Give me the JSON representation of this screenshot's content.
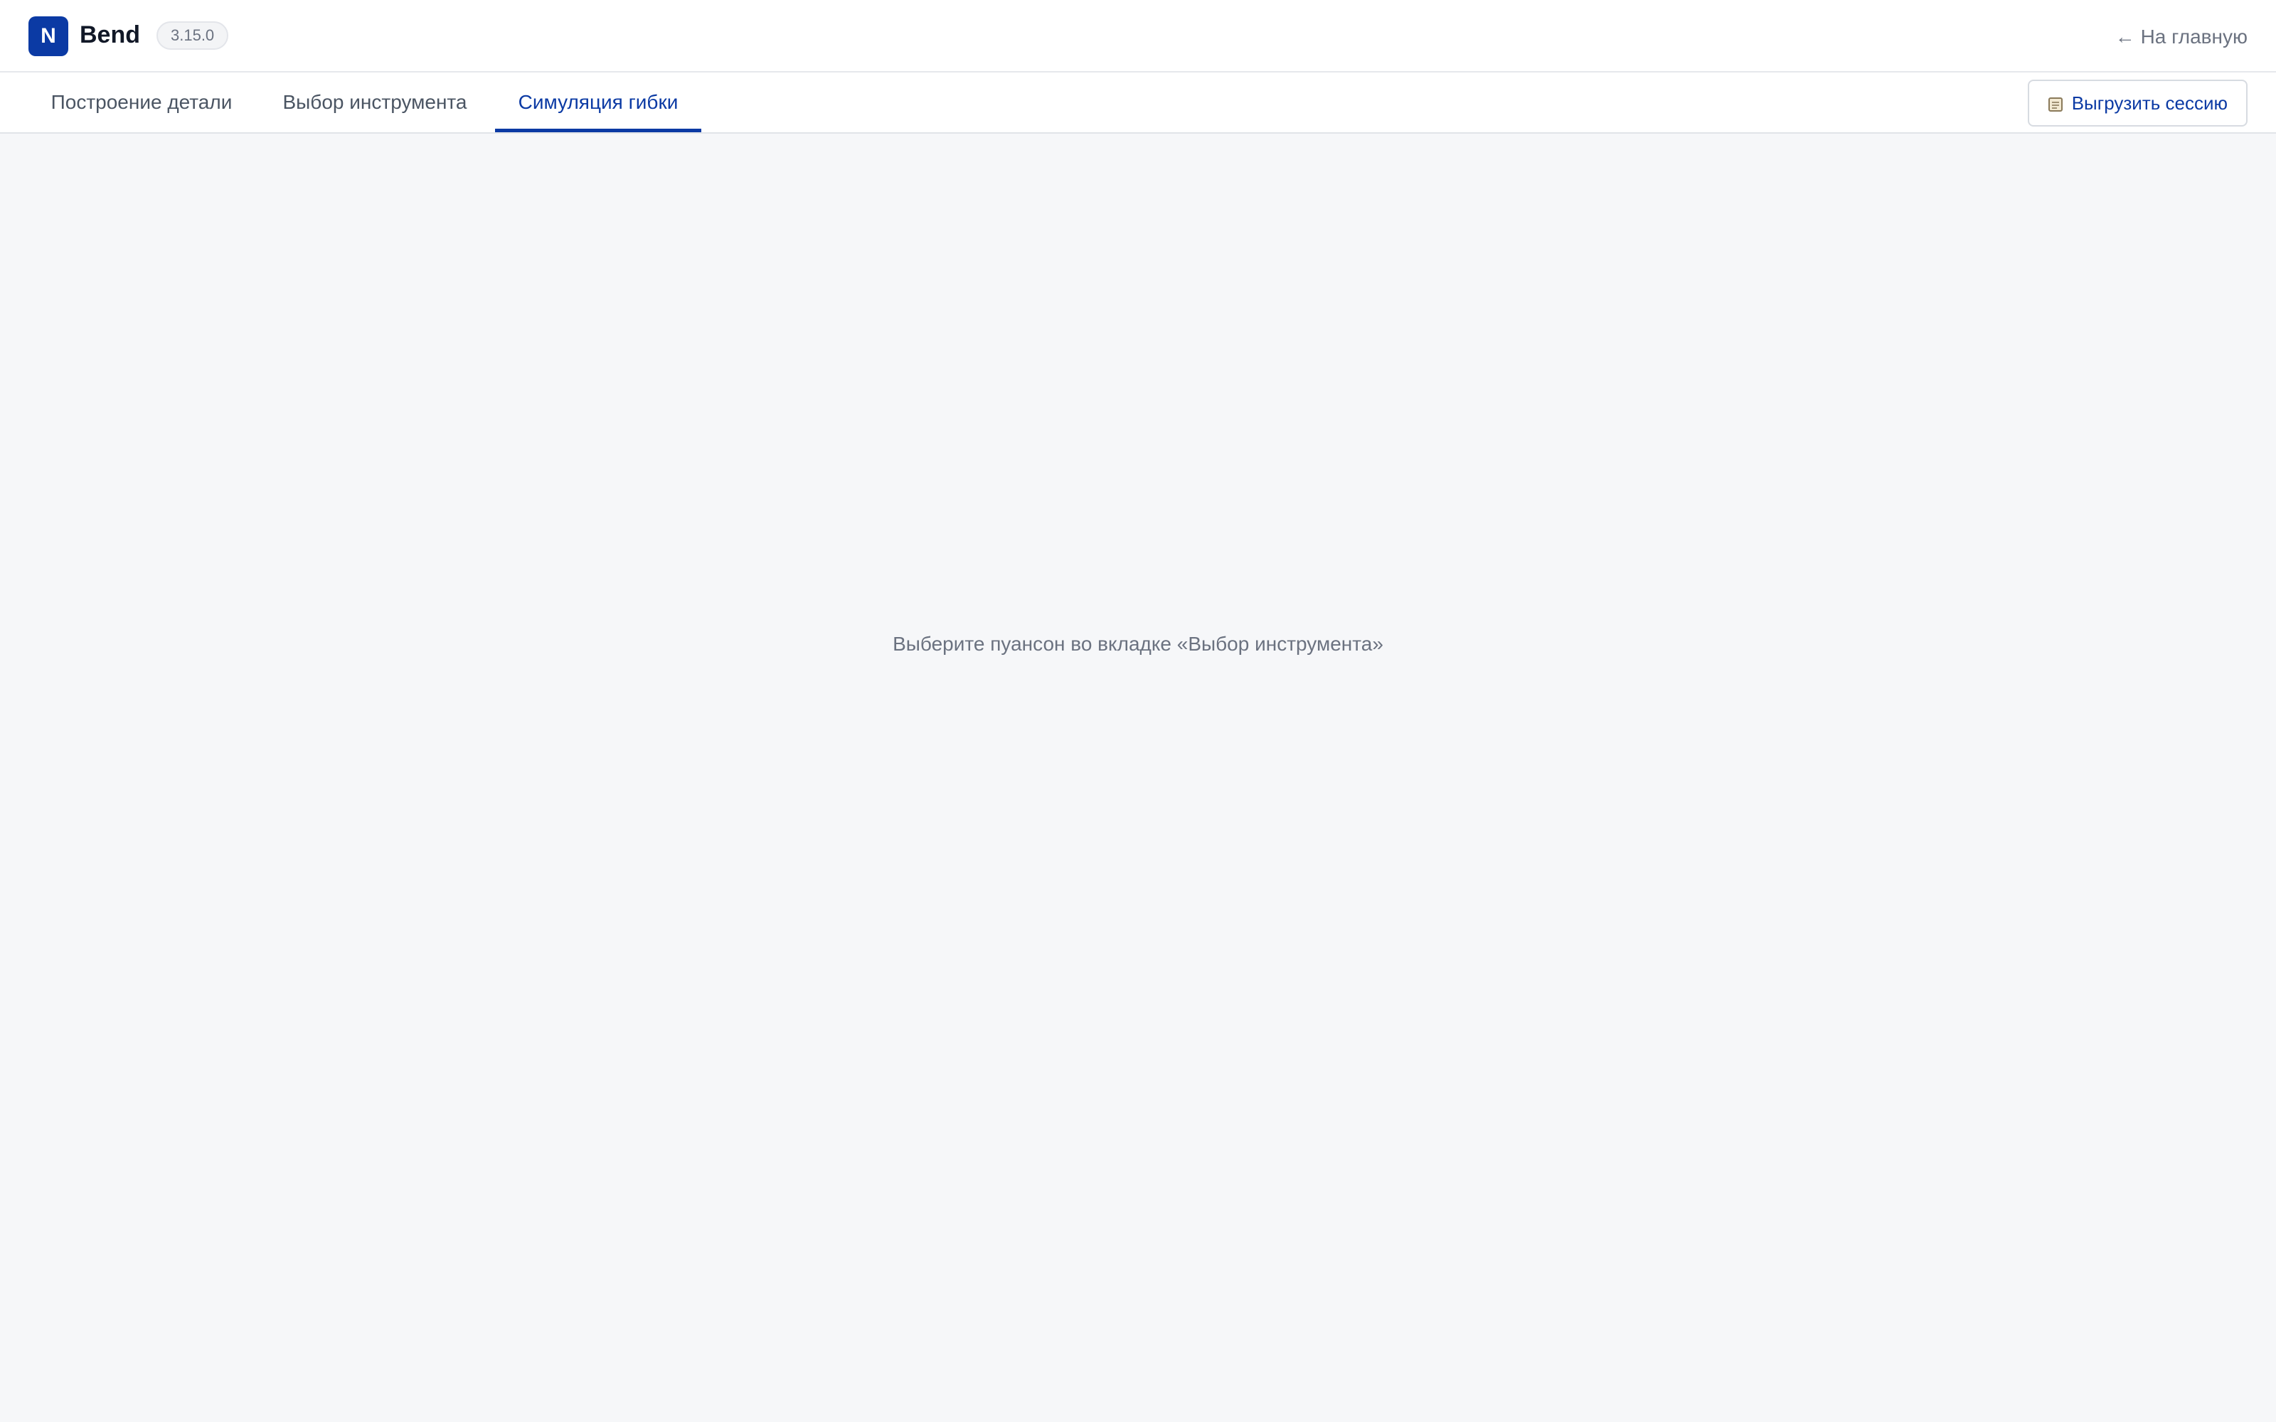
{
  "header": {
    "logo_letter": "N",
    "app_name": "Bend",
    "version": "3.15.0",
    "home_link": "На главную",
    "home_icon": "arrow-left-icon"
  },
  "tabs": [
    {
      "label": "Построение детали",
      "active": false
    },
    {
      "label": "Выбор инструмента",
      "active": false
    },
    {
      "label": "Симуляция гибки",
      "active": true
    }
  ],
  "toolbar": {
    "export_label": "Выгрузить сессию",
    "export_icon": "document-icon"
  },
  "main": {
    "empty_message": "Выберите пуансон во вкладке «Выбор инструмента»"
  },
  "colors": {
    "accent": "#0b3aa4",
    "background": "#f6f7f9",
    "muted_text": "#6b7280"
  }
}
